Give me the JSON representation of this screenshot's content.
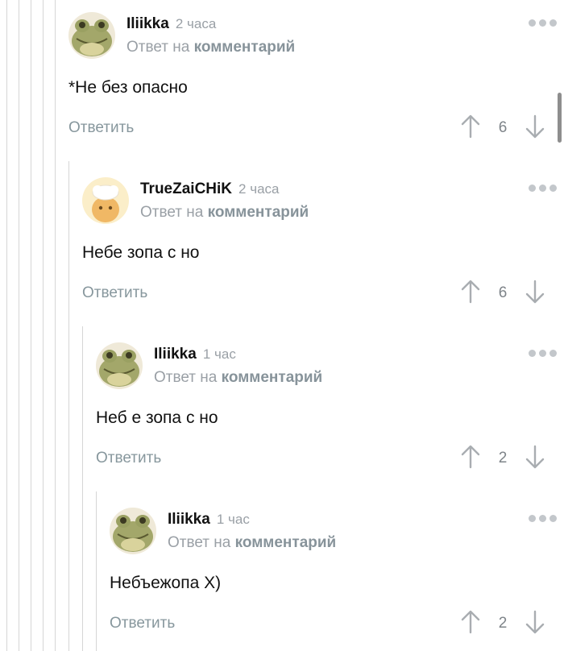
{
  "comments": [
    {
      "author": "Iliikka",
      "time": "2 часа",
      "reply_prefix": "Ответ на",
      "reply_link": "комментарий",
      "text": "*Не без опасно",
      "reply_label": "Ответить",
      "score": "6",
      "avatar_icon": "frog-avatar-icon"
    },
    {
      "author": "TrueZaiCHiK",
      "time": "2 часа",
      "reply_prefix": "Ответ на",
      "reply_link": "комментарий",
      "text": "Небе зопа с но",
      "reply_label": "Ответить",
      "score": "6",
      "avatar_icon": "chef-avatar-icon"
    },
    {
      "author": "Iliikka",
      "time": "1 час",
      "reply_prefix": "Ответ на",
      "reply_link": "комментарий",
      "text": "Неб е зопа с но",
      "reply_label": "Ответить",
      "score": "2",
      "avatar_icon": "frog-avatar-icon"
    },
    {
      "author": "Iliikka",
      "time": "1 час",
      "reply_prefix": "Ответ на",
      "reply_link": "комментарий",
      "text": "Небъежопа X)",
      "reply_label": "Ответить",
      "score": "2",
      "avatar_icon": "frog-avatar-icon"
    }
  ],
  "colors": {
    "meta_gray": "#9aa0a6",
    "reply_gray": "#87979d",
    "thread_line": "#d6d6d6"
  }
}
